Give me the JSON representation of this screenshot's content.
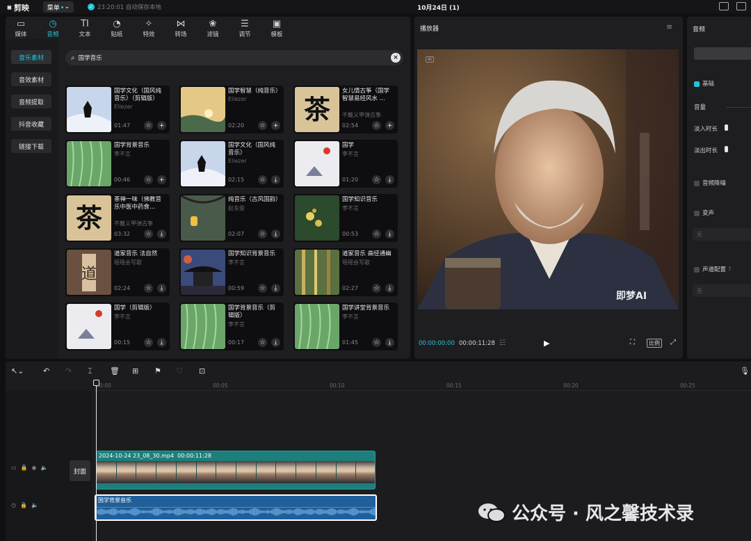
{
  "app": {
    "logo": "剪映",
    "menu_label": "菜单",
    "save_status": "23:20:01 自动保存本地",
    "project_title": "10月24日 (1)"
  },
  "library": {
    "categories": [
      {
        "label": "媒体",
        "icon": "media-icon"
      },
      {
        "label": "音频",
        "icon": "audio-icon",
        "active": true
      },
      {
        "label": "文本",
        "icon": "text-icon",
        "glyph": "TI"
      },
      {
        "label": "贴纸",
        "icon": "sticker-icon"
      },
      {
        "label": "特效",
        "icon": "effects-icon"
      },
      {
        "label": "转场",
        "icon": "transition-icon"
      },
      {
        "label": "滤镜",
        "icon": "filter-icon"
      },
      {
        "label": "调节",
        "icon": "adjust-icon"
      },
      {
        "label": "模板",
        "icon": "template-icon"
      }
    ],
    "subnav": [
      "音乐素材",
      "音效素材",
      "音频提取",
      "抖音收藏",
      "链接下载"
    ],
    "search_value": "国学音乐",
    "tracks": [
      {
        "title": "国学文化（国风纯音乐）（剪辑版）",
        "artist": "Eliezer",
        "duration": "01:47",
        "thumb": "snow",
        "action": "add"
      },
      {
        "title": "国学智慧（纯音乐）",
        "artist": "Eliezer",
        "duration": "02:20",
        "thumb": "sunset",
        "action": "add"
      },
      {
        "title": "女儿情古筝（国学智慧易经风水 ...",
        "artist": "不戴义甲弹古筝",
        "duration": "02:54",
        "thumb": "tea",
        "action": "add"
      },
      {
        "title": "国学背景音乐",
        "artist": "李不言",
        "duration": "00:46",
        "thumb": "willow",
        "action": "add"
      },
      {
        "title": "国学文化（国风纯音乐）",
        "artist": "Eliezer",
        "duration": "02:15",
        "thumb": "snow",
        "action": "download"
      },
      {
        "title": "国学",
        "artist": "李不言",
        "duration": "01:20",
        "thumb": "redsun",
        "action": "download"
      },
      {
        "title": "茶禅一味（佛教音乐中医中药食...",
        "artist": "不戴义甲弹古筝",
        "duration": "03:32",
        "thumb": "tea",
        "action": "download"
      },
      {
        "title": "纯音乐（古风国韵）",
        "artist": "赵东俊",
        "duration": "02:07",
        "thumb": "lantern",
        "action": "download"
      },
      {
        "title": "国学知识音乐",
        "artist": "李不言",
        "duration": "00:53",
        "thumb": "flower",
        "action": "download"
      },
      {
        "title": "道家音乐 法自然",
        "artist": "瑶瑶会写歌",
        "duration": "02:24",
        "thumb": "dao",
        "action": "download"
      },
      {
        "title": "国学知识背景音乐",
        "artist": "李不言",
        "duration": "00:59",
        "thumb": "pagoda",
        "action": "download"
      },
      {
        "title": "道家音乐 曲径通幽",
        "artist": "瑶瑶会写歌",
        "duration": "02:27",
        "thumb": "forest",
        "action": "download"
      },
      {
        "title": "国学（剪辑版）",
        "artist": "李不言",
        "duration": "00:15",
        "thumb": "redsun",
        "action": "download"
      },
      {
        "title": "国学背景音乐（剪辑版）",
        "artist": "李不言",
        "duration": "00:17",
        "thumb": "willow",
        "action": "download"
      },
      {
        "title": "国学讲堂背景音乐",
        "artist": "李不言",
        "duration": "01:45",
        "thumb": "willow",
        "action": "download"
      }
    ]
  },
  "player": {
    "title": "播放器",
    "ai_badge": "AI",
    "watermark": "即梦AI",
    "current_time": "00:00:00:00",
    "total_time": "00:00:11:28",
    "ratio_label": "比例"
  },
  "properties": {
    "title": "音频",
    "basic_label": "基础",
    "volume_label": "音量",
    "fade_in_label": "淡入时长",
    "fade_out_label": "淡出时长",
    "denoise_label": "音频降噪",
    "voice_change_label": "变声",
    "voice_change_value": "无",
    "channel_label": "声道配置",
    "channel_value": "无"
  },
  "timeline": {
    "ruler": [
      "00:00",
      "00:05",
      "00:10",
      "00:15",
      "00:20",
      "00:25"
    ],
    "cover_label": "封面",
    "video_clip": {
      "name": "2024-10-24 23_08_30.mp4",
      "duration": "00:00:11:28"
    },
    "audio_clip": {
      "name": "国学背景音乐"
    }
  },
  "watermark": {
    "text": "公众号 · 风之馨技术录"
  },
  "colors": {
    "accent": "#22c5d6",
    "audio_clip": "#1f5f9a",
    "video_clip": "#1d7f7c"
  }
}
